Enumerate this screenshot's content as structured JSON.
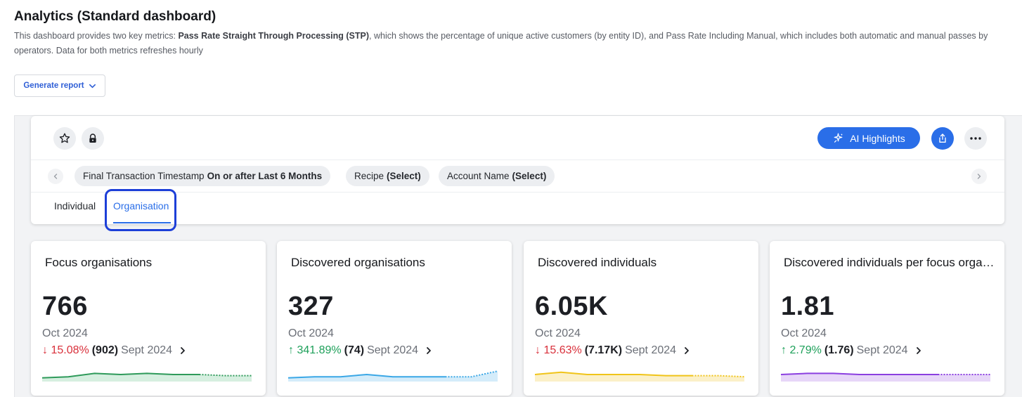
{
  "header": {
    "title": "Analytics (Standard dashboard)",
    "desc_part1": "This dashboard provides two key metrics: ",
    "desc_bold": "Pass Rate Straight Through Processing (STP)",
    "desc_part2": ", which shows the percentage of unique active customers (by entity ID), and Pass Rate Including Manual, which includes both automatic and manual passes by operators. Data for both metrics refreshes hourly",
    "generate_report_label": "Generate report"
  },
  "toolbar": {
    "ai_highlights_label": "AI Highlights"
  },
  "filters": [
    {
      "name": "Final Transaction Timestamp",
      "value": "On or after Last 6 Months"
    },
    {
      "name": "Recipe",
      "value": "(Select)"
    },
    {
      "name": "Account Name",
      "value": "(Select)"
    }
  ],
  "tabs": [
    {
      "label": "Individual",
      "active": false
    },
    {
      "label": "Organisation",
      "active": true
    }
  ],
  "cards": [
    {
      "title": "Focus organisations",
      "value": "766",
      "period": "Oct 2024",
      "change": "15.08%",
      "direction": "down",
      "previous": "(902)",
      "previous_period": "Sept 2024",
      "color": "#2e9a5a",
      "fill": "#d6efe0",
      "trend": [
        2,
        3,
        6,
        5,
        6,
        5,
        5,
        4,
        4
      ]
    },
    {
      "title": "Discovered organisations",
      "value": "327",
      "period": "Oct 2024",
      "change": "341.89%",
      "direction": "up",
      "previous": "(74)",
      "previous_period": "Sept 2024",
      "color": "#3aa7e6",
      "fill": "#d4ecfa",
      "trend": [
        2,
        3,
        3,
        5,
        3,
        3,
        3,
        3,
        8
      ]
    },
    {
      "title": "Discovered individuals",
      "value": "6.05K",
      "period": "Oct 2024",
      "change": "15.63%",
      "direction": "down",
      "previous": "(7.17K)",
      "previous_period": "Sept 2024",
      "color": "#f0c419",
      "fill": "#fbf0c8",
      "trend": [
        5,
        7,
        5,
        5,
        5,
        4,
        4,
        4,
        3
      ]
    },
    {
      "title": "Discovered individuals per focus organisation",
      "value": "1.81",
      "period": "Oct 2024",
      "change": "2.79%",
      "direction": "up",
      "previous": "(1.76)",
      "previous_period": "Sept 2024",
      "color": "#8b3fe0",
      "fill": "#e7d6f8",
      "trend": [
        5,
        6,
        6,
        5,
        5,
        5,
        5,
        5,
        5
      ]
    }
  ],
  "colors": {
    "accent": "#2a6ee8",
    "focus_ring": "#1d3fd8",
    "negative": "#d9303b",
    "positive": "#1ea05a"
  },
  "icons": {
    "favorite": "star-icon",
    "lock": "lock-icon",
    "ai": "sparkle-icon",
    "share": "share-icon",
    "more": "more-icon",
    "dropdown": "chevron-down-icon",
    "scroll_left": "chevron-left-icon",
    "scroll_right": "chevron-right-icon",
    "change_down": "arrow-down-icon",
    "change_up": "arrow-up-icon",
    "drill": "chevron-right-icon"
  }
}
